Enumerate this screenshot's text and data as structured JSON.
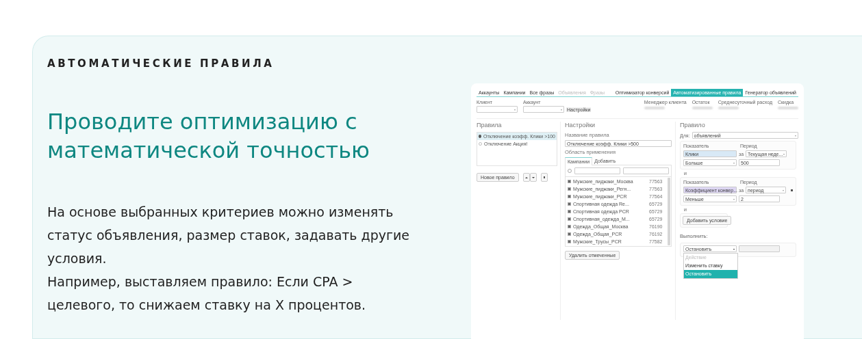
{
  "section_label": "АВТОМАТИЧЕСКИЕ ПРАВИЛА",
  "title": "Проводите оптимизацию с математической точностью",
  "description": [
    "На основе выбранных критериев можно изменять статус объявления, размер ставок, задавать другие условия.",
    "Например, выставляем правило: Если CPA > целевого, то снижаем ставку на X процентов."
  ],
  "app": {
    "nav_tabs": [
      {
        "label": "Аккаунты",
        "disabled": false
      },
      {
        "label": "Кампании",
        "disabled": false
      },
      {
        "label": "Все фразы",
        "disabled": false
      },
      {
        "label": "Объявления",
        "disabled": true
      },
      {
        "label": "Фразы",
        "disabled": true
      }
    ],
    "mode_tabs": [
      {
        "label": "Оптимизатор конверсий",
        "selected": false
      },
      {
        "label": "Автоматизированные правила",
        "selected": true
      },
      {
        "label": "Генератор объявлений",
        "selected": false
      }
    ],
    "filters": [
      {
        "label": "Клиент"
      },
      {
        "label": "Аккаунт"
      }
    ],
    "settings_link": "Настройки",
    "info_columns": [
      {
        "label": "Менеджер клиента"
      },
      {
        "label": "Остаток"
      },
      {
        "label": "Среднесуточный расход"
      },
      {
        "label": "Скидка"
      }
    ],
    "rules_panel": {
      "title": "Правила",
      "rules": [
        {
          "label": "Отключение коэфф. Клики >100",
          "selected": true
        },
        {
          "label": "Отключение Акция!",
          "selected": false
        }
      ],
      "new_button": "Новое правило"
    },
    "settings": {
      "title": "Настройки",
      "name_label": "Название правила",
      "name_value": "Отключение коэфф. Клики >500",
      "scope_label": "Область применения",
      "scope_tabs": [
        {
          "label": "Кампании",
          "selected": true
        },
        {
          "label": "Добавить",
          "selected": false
        }
      ],
      "select_all": {
        "checked": false
      },
      "campaigns": [
        {
          "name": "Мужские_пиджаки_Москва",
          "id": "77563",
          "checked": true
        },
        {
          "name": "Мужские_пиджаки_Регн...",
          "id": "77563",
          "checked": true
        },
        {
          "name": "Мужские_пиджаки_PCR",
          "id": "77564",
          "checked": true
        },
        {
          "name": "Спортивная одежда Re...",
          "id": "65729",
          "checked": true
        },
        {
          "name": "Спортивная одежда PCR",
          "id": "65729",
          "checked": true
        },
        {
          "name": "Спортивная_одежда_М...",
          "id": "65729",
          "checked": true
        },
        {
          "name": "Одежда_Общая_Москва",
          "id": "76190",
          "checked": true
        },
        {
          "name": "Одежда_Общая_PCR",
          "id": "76192",
          "checked": true
        },
        {
          "name": "Мужские_Трусы_PCR",
          "id": "77582",
          "checked": true
        }
      ],
      "delete_button": "Удалить отмеченные"
    },
    "rule": {
      "title": "Правило",
      "for_label": "Для:",
      "for_value": "объявлений",
      "conditions": [
        {
          "metric_label": "Показатель",
          "period_label": "Период",
          "metric": "Клики",
          "color": "#d8e9f6",
          "for_word": "за",
          "period": "Текущая неде...",
          "comparison": "Больше",
          "value": "500",
          "removable": false,
          "joiner": "и"
        },
        {
          "metric_label": "Показатель",
          "period_label": "Период",
          "metric": "Коэффициент конвер...",
          "color": "#ddd6f3",
          "for_word": "за",
          "period": "период",
          "comparison": "Меньше",
          "value": "2",
          "removable": true,
          "joiner": "и"
        }
      ],
      "add_condition": "Добавить условие",
      "execute_label": "Выполнить:",
      "action_value": "Остановить",
      "action_options": [
        {
          "label": "Действие",
          "disabled": true,
          "selected": false
        },
        {
          "label": "Изменить ставку",
          "disabled": false,
          "selected": false
        },
        {
          "label": "Остановить",
          "disabled": false,
          "selected": true
        }
      ]
    }
  }
}
